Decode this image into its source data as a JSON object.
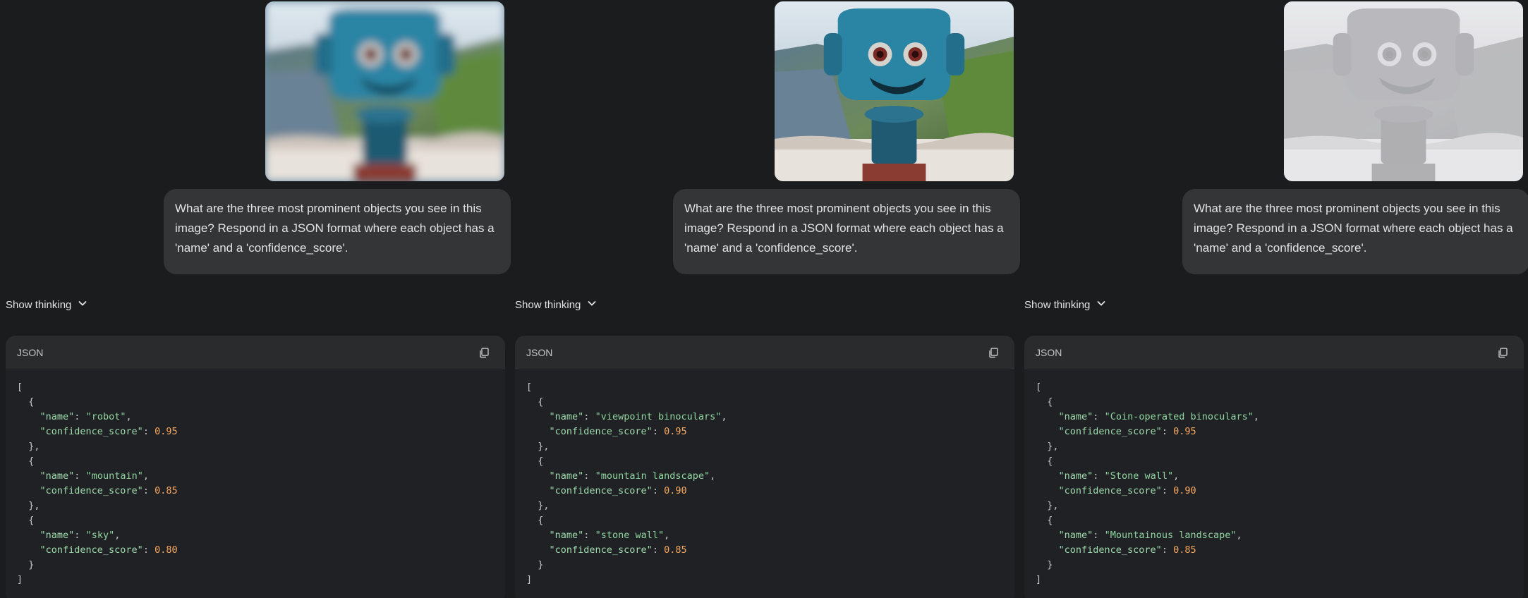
{
  "prompt_text": "What are the three most prominent objects you see in this image? Respond in a JSON format where each object has a 'name' and a 'confidence_score'.",
  "thinking_label": "Show thinking",
  "code_lang": "JSON",
  "icons": {
    "thinking_toggle": "chevron-down-icon",
    "copy": "copy-icon"
  },
  "colors": {
    "background": "#1b1c1d",
    "bubble": "#333537",
    "code_bg": "#202124",
    "code_header": "#2a2b2d",
    "string": "#8fd6a0",
    "number": "#f8a961"
  },
  "panels": [
    {
      "image_variant": "blurred",
      "objects": [
        {
          "name": "\"robot\"",
          "score": "0.95"
        },
        {
          "name": "\"mountain\"",
          "score": "0.85"
        },
        {
          "name": "\"sky\"",
          "score": "0.80"
        }
      ]
    },
    {
      "image_variant": "original",
      "objects": [
        {
          "name": "\"viewpoint binoculars\"",
          "score": "0.95"
        },
        {
          "name": "\"mountain landscape\"",
          "score": "0.90"
        },
        {
          "name": "\"stone wall\"",
          "score": "0.85"
        }
      ]
    },
    {
      "image_variant": "high-pass",
      "objects": [
        {
          "name": "\"Coin-operated binoculars\"",
          "score": "0.95"
        },
        {
          "name": "\"Stone wall\"",
          "score": "0.90"
        },
        {
          "name": "\"Mountainous landscape\"",
          "score": "0.85"
        }
      ]
    }
  ],
  "json_tokens": {
    "open_bracket": "[",
    "close_bracket": "]",
    "open_brace": "{",
    "close_brace": "}",
    "close_brace_comma": "},",
    "key_name": "\"name\"",
    "key_score": "\"confidence_score\"",
    "colon": ": ",
    "comma": ","
  }
}
